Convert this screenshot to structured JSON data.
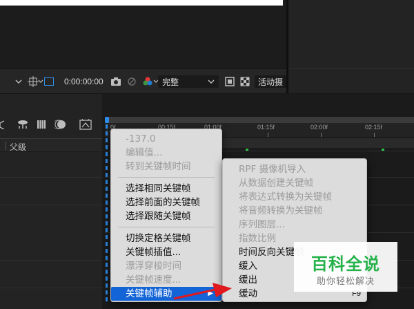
{
  "viewer_toolbar": {
    "timecode": "0:00:00:00",
    "resolution": "完整",
    "active_camera": "活动摄"
  },
  "timeline": {
    "parent_column": "父级",
    "ruler_ticks": [
      "0f",
      "00:15f",
      "01:00f",
      "01:15f",
      "02:00f",
      "02:15f"
    ]
  },
  "context_menu": {
    "items": [
      {
        "label": "-137.0",
        "enabled": false
      },
      {
        "label": "编辑值...",
        "enabled": false
      },
      {
        "label": "转到关键帧时间",
        "enabled": false
      },
      {
        "label": "选择相同关键帧",
        "enabled": true
      },
      {
        "label": "选择前面的关键帧",
        "enabled": true
      },
      {
        "label": "选择跟随关键帧",
        "enabled": true
      },
      {
        "label": "切换定格关键帧",
        "enabled": true
      },
      {
        "label": "关键帧插值...",
        "enabled": true
      },
      {
        "label": "漂浮穿梭时间",
        "enabled": false
      },
      {
        "label": "关键帧速度...",
        "enabled": false
      },
      {
        "label": "关键帧辅助",
        "enabled": true,
        "highlighted": true,
        "submenu_arrow": "▶"
      }
    ]
  },
  "submenu": {
    "items": [
      {
        "label": "RPF 摄像机导入",
        "enabled": false
      },
      {
        "label": "从数据创建关键帧",
        "enabled": false
      },
      {
        "label": "将表达式转换为关键帧",
        "enabled": false
      },
      {
        "label": "将音频转换为关键帧",
        "enabled": false
      },
      {
        "label": "序列图层...",
        "enabled": false
      },
      {
        "label": "指数比例",
        "enabled": false
      },
      {
        "label": "时间反向关键帧",
        "enabled": true
      },
      {
        "label": "缓入",
        "enabled": true
      },
      {
        "label": "缓出",
        "enabled": true
      },
      {
        "label": "缓动",
        "enabled": true,
        "shortcut": "F9"
      }
    ]
  },
  "watermark": {
    "title": "百科全说",
    "subtitle": "助你轻松解决"
  },
  "colors": {
    "highlight": "#1364d6",
    "accent": "#2d8ceb",
    "keyframe": "#35c24a",
    "pointer_arrow": "#e0191f",
    "watermark_green": "#25b24a"
  }
}
